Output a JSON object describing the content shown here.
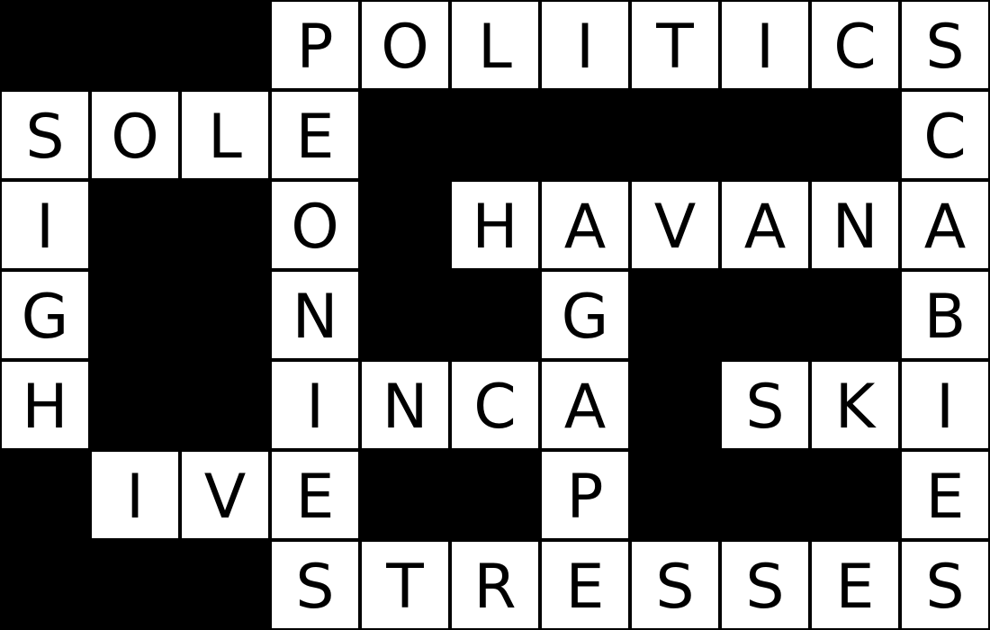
{
  "colors": {
    "block": "#000000",
    "open": "#ffffff",
    "letter": "#000000"
  },
  "grid": {
    "rows": [
      [
        "#",
        "#",
        "#",
        "P",
        "O",
        "L",
        "I",
        "T",
        "I",
        "C",
        "S"
      ],
      [
        "S",
        "O",
        "L",
        "E",
        "#",
        "#",
        "#",
        "#",
        "#",
        "#",
        "C"
      ],
      [
        "I",
        "#",
        "#",
        "O",
        "#",
        "H",
        "A",
        "V",
        "A",
        "N",
        "A"
      ],
      [
        "G",
        "#",
        "#",
        "N",
        "#",
        "#",
        "G",
        "#",
        "#",
        "#",
        "B"
      ],
      [
        "H",
        "#",
        "#",
        "I",
        "N",
        "C",
        "A",
        "#",
        "S",
        "K",
        "I"
      ],
      [
        "#",
        "I",
        "V",
        "E",
        "#",
        "#",
        "P",
        "#",
        "#",
        "#",
        "E"
      ],
      [
        "#",
        "#",
        "#",
        "S",
        "T",
        "R",
        "E",
        "S",
        "S",
        "E",
        "S"
      ]
    ]
  }
}
